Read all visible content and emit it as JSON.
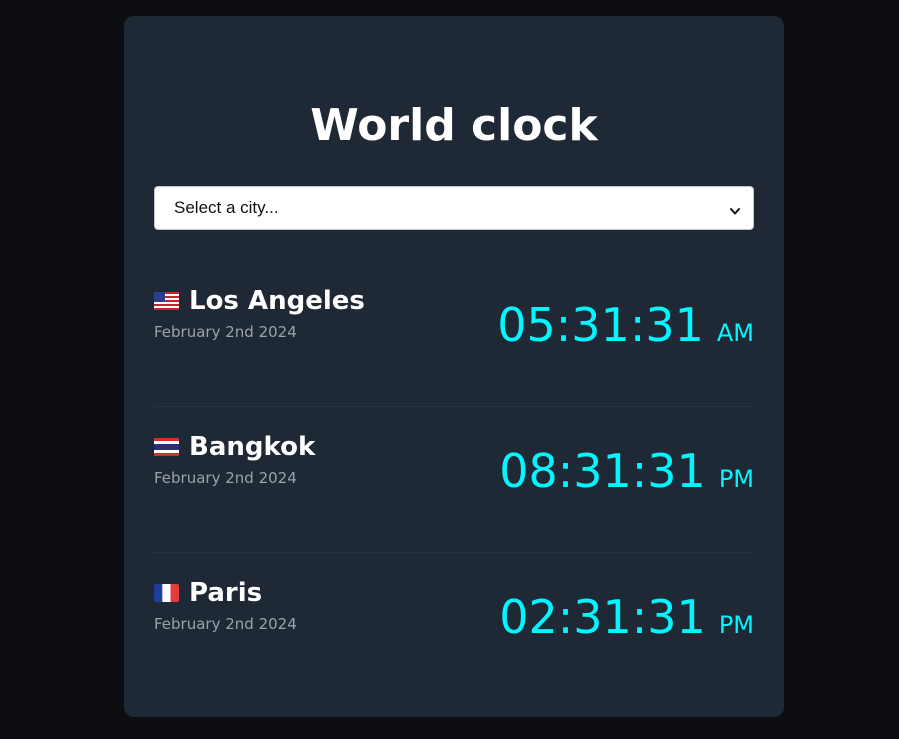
{
  "title": "World clock",
  "select": {
    "value": "Select a city..."
  },
  "cities": [
    {
      "flag": "flag-us-icon",
      "name": "Los Angeles",
      "date": "February 2nd 2024",
      "time": "05:31:31",
      "ampm": "AM"
    },
    {
      "flag": "flag-th-icon",
      "name": "Bangkok",
      "date": "February 2nd 2024",
      "time": "08:31:31",
      "ampm": "PM"
    },
    {
      "flag": "flag-fr-icon",
      "name": "Paris",
      "date": "February 2nd 2024",
      "time": "02:31:31",
      "ampm": "PM"
    }
  ],
  "colors": {
    "page_background": "#0d0e12",
    "card_background": "#1f2835",
    "time_accent": "#00f7ff",
    "date_text": "#9aa3ad"
  }
}
